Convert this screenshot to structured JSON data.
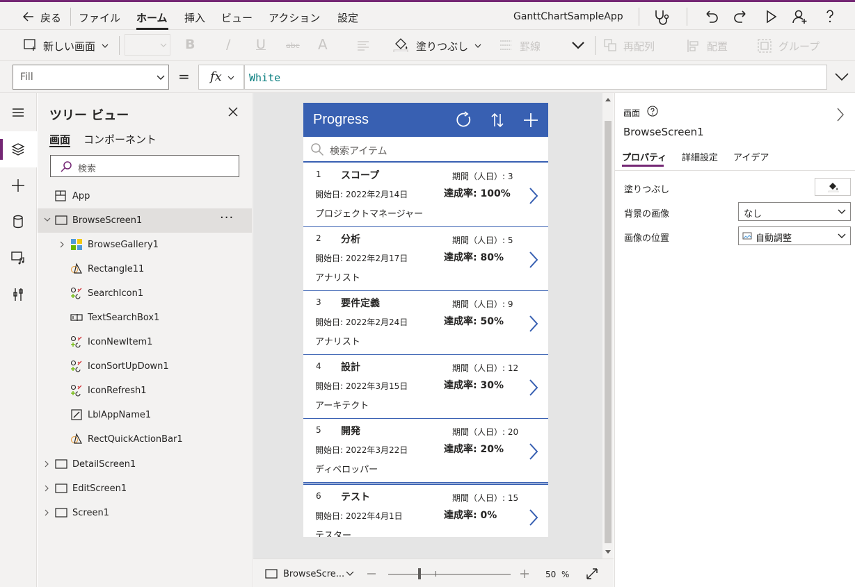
{
  "menubar": {
    "back": "戻る",
    "items": [
      "ファイル",
      "ホーム",
      "挿入",
      "ビュー",
      "アクション",
      "設定"
    ],
    "app_name": "GanttChartSampleApp"
  },
  "toolbar": {
    "new_screen": "新しい画面",
    "fill": "塗りつぶし",
    "border": "罫線",
    "reorder": "再配列",
    "align": "配置",
    "group": "グループ"
  },
  "formula": {
    "property": "Fill",
    "equals": "=",
    "fx": "fx",
    "value": "White"
  },
  "tree": {
    "title": "ツリー ビュー",
    "tabs": [
      "画面",
      "コンポーネント"
    ],
    "search_placeholder": "検索",
    "nodes": [
      "App",
      "BrowseScreen1",
      "BrowseGallery1",
      "Rectangle11",
      "SearchIcon1",
      "TextSearchBox1",
      "IconNewItem1",
      "IconSortUpDown1",
      "IconRefresh1",
      "LblAppName1",
      "RectQuickActionBar1",
      "DetailScreen1",
      "EditScreen1",
      "Screen1"
    ],
    "more": "···"
  },
  "app": {
    "title": "Progress",
    "search_placeholder": "検索アイテム",
    "items": [
      {
        "num": "1",
        "name": "スコープ",
        "duration": "期間（人日）: 3",
        "start": "開始日: 2022年2月14日",
        "rate": "達成率: 100%",
        "role": "プロジェクトマネージャー"
      },
      {
        "num": "2",
        "name": "分析",
        "duration": "期間（人日）: 5",
        "start": "開始日: 2022年2月17日",
        "rate": "達成率: 80%",
        "role": "アナリスト"
      },
      {
        "num": "3",
        "name": "要件定義",
        "duration": "期間（人日）: 9",
        "start": "開始日: 2022年2月24日",
        "rate": "達成率: 50%",
        "role": "アナリスト"
      },
      {
        "num": "4",
        "name": "設計",
        "duration": "期間（人日）: 12",
        "start": "開始日: 2022年3月15日",
        "rate": "達成率: 30%",
        "role": "アーキテクト"
      },
      {
        "num": "5",
        "name": "開発",
        "duration": "期間（人日）: 20",
        "start": "開始日: 2022年3月22日",
        "rate": "達成率: 20%",
        "role": "ディベロッパー"
      },
      {
        "num": "6",
        "name": "テスト",
        "duration": "期間（人日）: 15",
        "start": "開始日: 2022年4月1日",
        "rate": "達成率: 0%",
        "role": "テスター"
      }
    ]
  },
  "canvas": {
    "screen_selector": "BrowseScre...",
    "zoom_value": "50",
    "zoom_unit": "%"
  },
  "properties": {
    "kind": "画面",
    "name": "BrowseScreen1",
    "tabs": [
      "プロパティ",
      "詳細設定",
      "アイデア"
    ],
    "fill_label": "塗りつぶし",
    "bg_image_label": "背景の画像",
    "bg_image_value": "なし",
    "image_position_label": "画像の位置",
    "image_position_value": "自動調整"
  },
  "colors": {
    "brand": "#742774",
    "app_header": "#3860b2"
  }
}
